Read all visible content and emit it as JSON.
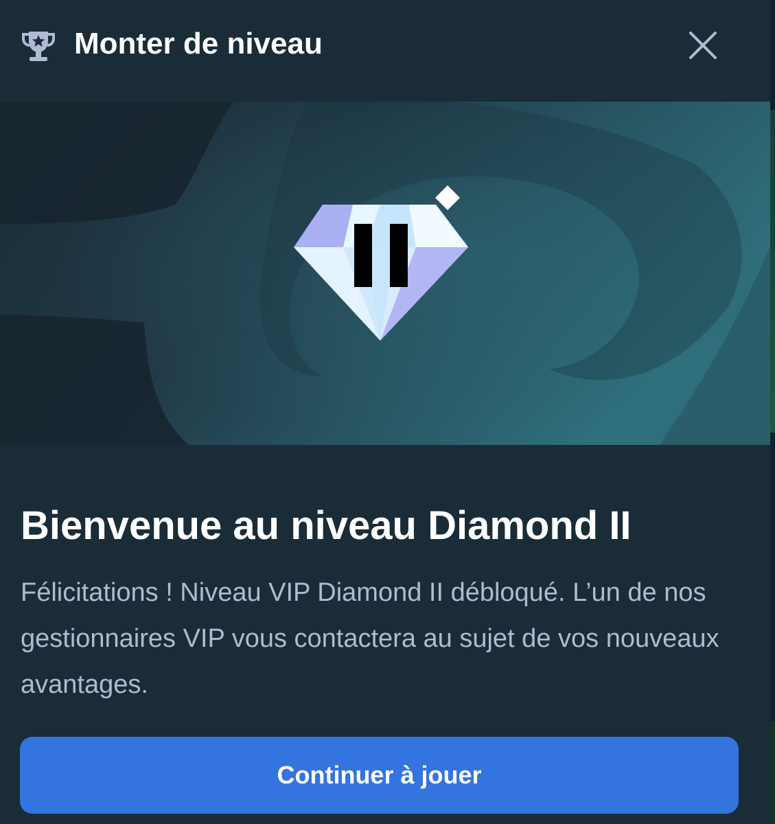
{
  "header": {
    "title": "Monter de niveau",
    "icon": "trophy-icon",
    "close_icon": "close-icon"
  },
  "banner": {
    "badge_icon": "diamond-tier-icon",
    "badge_text": "II"
  },
  "content": {
    "heading": "Bienvenue au niveau Diamond II",
    "description": "Félicitations ! Niveau VIP Diamond II débloqué. L’un de nos gestionnaires VIP vous contactera au sujet de vos nouveaux avantages."
  },
  "actions": {
    "continue_label": "Continuer à jouer"
  },
  "colors": {
    "background": "#1a2c38",
    "button": "#3474de",
    "text_primary": "#ffffff",
    "text_secondary": "#b1bad3"
  }
}
